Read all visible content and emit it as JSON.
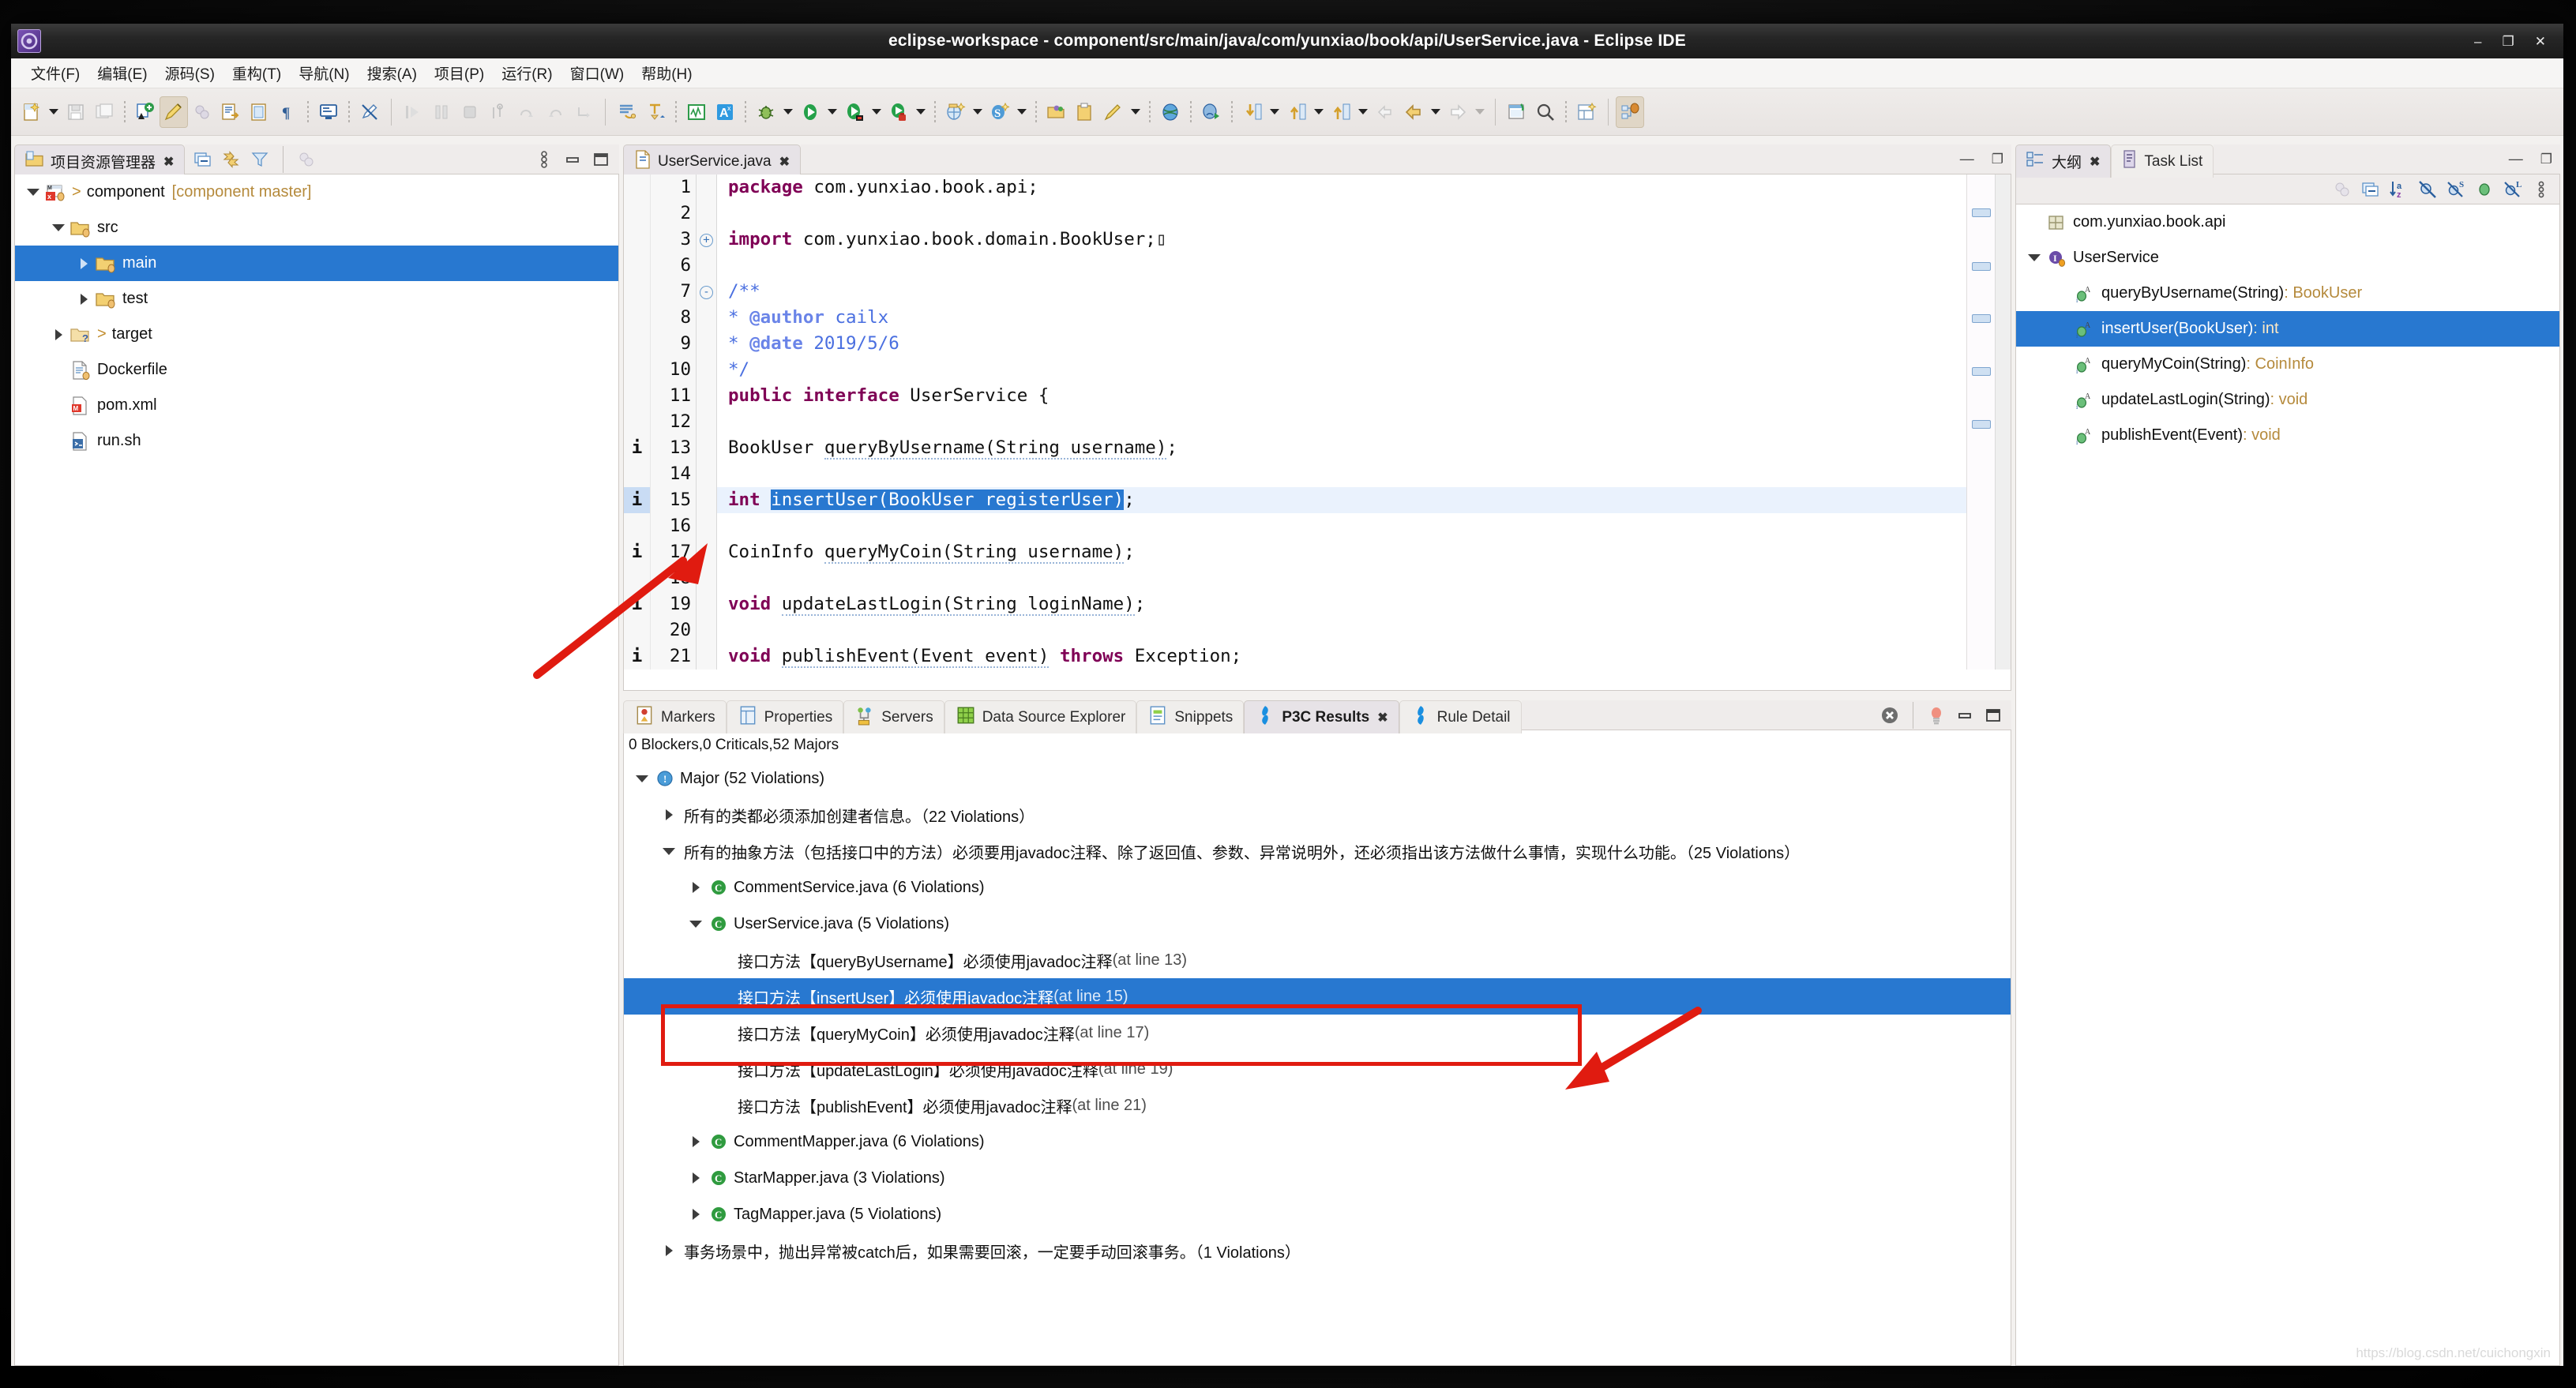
{
  "window": {
    "title": "eclipse-workspace - component/src/main/java/com/yunxiao/book/api/UserService.java - Eclipse IDE",
    "app_icon": "eclipse-icon",
    "minimize": "–",
    "restore": "❐",
    "close": "✕"
  },
  "menubar": {
    "items": [
      {
        "label": "文件(F)",
        "name": "menu-file"
      },
      {
        "label": "编辑(E)",
        "name": "menu-edit"
      },
      {
        "label": "源码(S)",
        "name": "menu-source"
      },
      {
        "label": "重构(T)",
        "name": "menu-refactor"
      },
      {
        "label": "导航(N)",
        "name": "menu-navigate"
      },
      {
        "label": "搜索(A)",
        "name": "menu-search"
      },
      {
        "label": "项目(P)",
        "name": "menu-project"
      },
      {
        "label": "运行(R)",
        "name": "menu-run"
      },
      {
        "label": "窗口(W)",
        "name": "menu-window"
      },
      {
        "label": "帮助(H)",
        "name": "menu-help"
      }
    ]
  },
  "explorer": {
    "tab_label": "项目资源管理器",
    "tab_close": "✖",
    "tools": [
      "collapse-all-icon",
      "link-with-editor-icon",
      "view-menu-filter-icon",
      "minimize-view-icon",
      "maximize-view-icon"
    ],
    "tree": [
      {
        "label": "component",
        "suffix": "[component master]",
        "prefix": ">",
        "depth": 0,
        "twisty": "down",
        "icon": "maven-project-icon",
        "selected": false
      },
      {
        "label": "src",
        "suffix": "",
        "prefix": "",
        "depth": 1,
        "twisty": "down",
        "icon": "source-folder-icon",
        "selected": false
      },
      {
        "label": "main",
        "suffix": "",
        "prefix": "",
        "depth": 2,
        "twisty": "right",
        "icon": "source-folder-icon",
        "selected": true
      },
      {
        "label": "test",
        "suffix": "",
        "prefix": "",
        "depth": 2,
        "twisty": "right",
        "icon": "source-folder-icon",
        "selected": false
      },
      {
        "label": "target",
        "suffix": "",
        "prefix": ">",
        "depth": 1,
        "twisty": "right",
        "icon": "folder-question-icon",
        "selected": false
      },
      {
        "label": "Dockerfile",
        "suffix": "",
        "prefix": "",
        "depth": 1,
        "twisty": "none",
        "icon": "file-icon",
        "selected": false
      },
      {
        "label": "pom.xml",
        "suffix": "",
        "prefix": "",
        "depth": 1,
        "twisty": "none",
        "icon": "maven-pom-icon",
        "selected": false
      },
      {
        "label": "run.sh",
        "suffix": "",
        "prefix": "",
        "depth": 1,
        "twisty": "none",
        "icon": "shell-script-icon",
        "selected": false
      }
    ]
  },
  "editor": {
    "tab_label": "UserService.java",
    "tab_close": "✖",
    "minimize": "—",
    "maximize": "❐",
    "lines": [
      {
        "no": "1",
        "marker": "",
        "fold": "",
        "indent": 0,
        "html": "<span class='kw'>package</span> com.yunxiao.book.api;",
        "hl": false
      },
      {
        "no": "2",
        "marker": "",
        "fold": "",
        "indent": 0,
        "html": "",
        "hl": false
      },
      {
        "no": "3",
        "marker": "",
        "fold": "+",
        "indent": 0,
        "html": "<span class='kw'>import</span> com.yunxiao.book.domain.BookUser;&#9647;",
        "hl": false
      },
      {
        "no": "6",
        "marker": "",
        "fold": "",
        "indent": 0,
        "html": "",
        "hl": false
      },
      {
        "no": "7",
        "marker": "",
        "fold": "-",
        "indent": 0,
        "html": "<span class='jdoc'>/**</span>",
        "hl": false
      },
      {
        "no": "8",
        "marker": "",
        "fold": "",
        "indent": 0,
        "html": "<span class='jdoc'> * </span><span class='jtag'>@author</span><span class='jdoc'> cailx</span>",
        "hl": false
      },
      {
        "no": "9",
        "marker": "",
        "fold": "",
        "indent": 0,
        "html": "<span class='jdoc'> * </span><span class='jtag'>@date</span><span class='jdoc'> 2019/5/6</span>",
        "hl": false
      },
      {
        "no": "10",
        "marker": "",
        "fold": "",
        "indent": 0,
        "html": "<span class='jdoc'> */</span>",
        "hl": false
      },
      {
        "no": "11",
        "marker": "",
        "fold": "",
        "indent": 0,
        "html": "<span class='kw'>public</span> <span class='kw'>interface</span> UserService {",
        "hl": false
      },
      {
        "no": "12",
        "marker": "",
        "fold": "",
        "indent": 0,
        "html": "",
        "hl": false
      },
      {
        "no": "13",
        "marker": "i",
        "fold": "",
        "indent": 0,
        "html": "    BookUser <span class='mref'>queryByUsername(String username)</span>;",
        "hl": false
      },
      {
        "no": "14",
        "marker": "",
        "fold": "",
        "indent": 0,
        "html": "",
        "hl": false
      },
      {
        "no": "15",
        "marker": "i",
        "fold": "",
        "indent": 0,
        "html": "    <span class='kw'>int</span> <span class='selx'>insertUser(BookUser registerUser)</span>;",
        "hl": true
      },
      {
        "no": "16",
        "marker": "",
        "fold": "",
        "indent": 0,
        "html": "",
        "hl": false
      },
      {
        "no": "17",
        "marker": "i",
        "fold": "",
        "indent": 0,
        "html": "    CoinInfo <span class='mref'>queryMyCoin(String username)</span>;",
        "hl": false
      },
      {
        "no": "18",
        "marker": "",
        "fold": "",
        "indent": 0,
        "html": "",
        "hl": false
      },
      {
        "no": "19",
        "marker": "i",
        "fold": "",
        "indent": 0,
        "html": "    <span class='kw'>void</span> <span class='mref'>updateLastLogin(String loginName)</span>;",
        "hl": false
      },
      {
        "no": "20",
        "marker": "",
        "fold": "",
        "indent": 0,
        "html": "",
        "hl": false
      },
      {
        "no": "21",
        "marker": "i",
        "fold": "",
        "indent": 0,
        "html": "    <span class='kw'>void</span> <span class='mref'>publishEvent(Event event)</span> <span class='kw'>throws</span> Exception;",
        "hl": false
      }
    ]
  },
  "outline": {
    "tab_label": "大纲",
    "tab_close": "✖",
    "tab2_label": "Task List",
    "tools": [
      "focus-on-active-task-icon",
      "collapse-all-icon",
      "sort-alphabetically-icon",
      "hide-non-public-icon",
      "hide-static-icon",
      "hide-fields-icon",
      "hide-local-types-icon",
      "view-menu-icon"
    ],
    "minimize": "—",
    "maximize": "❐",
    "items": [
      {
        "label": "com.yunxiao.book.api",
        "ret": "",
        "depth": 0,
        "twisty": "none",
        "icon": "package-icon",
        "selected": false
      },
      {
        "label": "UserService",
        "ret": "",
        "depth": 0,
        "twisty": "down",
        "icon": "interface-icon",
        "selected": false
      },
      {
        "label": "queryByUsername(String)",
        "ret": " : BookUser",
        "depth": 1,
        "twisty": "none",
        "icon": "abstract-method-icon",
        "selected": false
      },
      {
        "label": "insertUser(BookUser)",
        "ret": " : int",
        "depth": 1,
        "twisty": "none",
        "icon": "abstract-method-icon",
        "selected": true
      },
      {
        "label": "queryMyCoin(String)",
        "ret": " : CoinInfo",
        "depth": 1,
        "twisty": "none",
        "icon": "abstract-method-icon",
        "selected": false
      },
      {
        "label": "updateLastLogin(String)",
        "ret": " : void",
        "depth": 1,
        "twisty": "none",
        "icon": "abstract-method-icon",
        "selected": false
      },
      {
        "label": "publishEvent(Event)",
        "ret": " : void",
        "depth": 1,
        "twisty": "none",
        "icon": "abstract-method-icon",
        "selected": false
      }
    ]
  },
  "bottom": {
    "tabs": [
      {
        "label": "Markers",
        "icon": "markers-icon",
        "selected": false,
        "close": false
      },
      {
        "label": "Properties",
        "icon": "properties-icon",
        "selected": false,
        "close": false
      },
      {
        "label": "Servers",
        "icon": "servers-icon",
        "selected": false,
        "close": false
      },
      {
        "label": "Data Source Explorer",
        "icon": "data-source-icon",
        "selected": false,
        "close": false
      },
      {
        "label": "Snippets",
        "icon": "snippets-icon",
        "selected": false,
        "close": false
      },
      {
        "label": "P3C Results",
        "icon": "p3c-icon",
        "selected": true,
        "close": true
      },
      {
        "label": "Rule Detail",
        "icon": "p3c-icon",
        "selected": false,
        "close": false
      }
    ],
    "tab_close": "✖",
    "tools": [
      "clear-results-icon",
      "quick-fix-icon",
      "minimize-view-icon",
      "maximize-view-icon"
    ],
    "status": "0 Blockers,0 Criticals,52 Majors",
    "tree": [
      {
        "label": "Major (52 Violations)",
        "depth": 0,
        "twisty": "down",
        "icon": "major-severity-icon",
        "selected": false,
        "atline": ""
      },
      {
        "label": "所有的类都必须添加创建者信息。（22 Violations）",
        "depth": 1,
        "twisty": "right",
        "icon": "",
        "selected": false,
        "atline": ""
      },
      {
        "label": "所有的抽象方法（包括接口中的方法）必须要用javadoc注释、除了返回值、参数、异常说明外，还必须指出该方法做什么事情，实现什么功能。（25 Violations）",
        "depth": 1,
        "twisty": "down",
        "icon": "",
        "selected": false,
        "atline": ""
      },
      {
        "label": "CommentService.java (6 Violations)",
        "depth": 2,
        "twisty": "right",
        "icon": "java-class-icon",
        "selected": false,
        "atline": ""
      },
      {
        "label": "UserService.java (5 Violations)",
        "depth": 2,
        "twisty": "down",
        "icon": "java-class-icon",
        "selected": false,
        "atline": ""
      },
      {
        "label": "接口方法【queryByUsername】必须使用javadoc注释",
        "depth": 3,
        "twisty": "none",
        "icon": "",
        "selected": false,
        "atline": " (at line 13)"
      },
      {
        "label": "接口方法【insertUser】必须使用javadoc注释",
        "depth": 3,
        "twisty": "none",
        "icon": "",
        "selected": true,
        "atline": " (at line 15)"
      },
      {
        "label": "接口方法【queryMyCoin】必须使用javadoc注释",
        "depth": 3,
        "twisty": "none",
        "icon": "",
        "selected": false,
        "atline": " (at line 17)"
      },
      {
        "label": "接口方法【updateLastLogin】必须使用javadoc注释",
        "depth": 3,
        "twisty": "none",
        "icon": "",
        "selected": false,
        "atline": " (at line 19)"
      },
      {
        "label": "接口方法【publishEvent】必须使用javadoc注释",
        "depth": 3,
        "twisty": "none",
        "icon": "",
        "selected": false,
        "atline": " (at line 21)"
      },
      {
        "label": "CommentMapper.java (6 Violations)",
        "depth": 2,
        "twisty": "right",
        "icon": "java-class-icon",
        "selected": false,
        "atline": ""
      },
      {
        "label": "StarMapper.java (3 Violations)",
        "depth": 2,
        "twisty": "right",
        "icon": "java-class-icon",
        "selected": false,
        "atline": ""
      },
      {
        "label": "TagMapper.java (5 Violations)",
        "depth": 2,
        "twisty": "right",
        "icon": "java-class-icon",
        "selected": false,
        "atline": ""
      },
      {
        "label": "事务场景中，抛出异常被catch后，如果需要回滚，一定要手动回滚事务。（1 Violations）",
        "depth": 1,
        "twisty": "right",
        "icon": "",
        "selected": false,
        "atline": ""
      }
    ]
  },
  "watermark": "https://blog.csdn.net/cuichongxin",
  "colors": {
    "selection_blue": "#2878d0",
    "annotation_red": "#e01b10",
    "keyword_purple": "#7f0055",
    "javadoc_blue": "#4a6fe0",
    "return_type_gold": "#b58a3c"
  }
}
